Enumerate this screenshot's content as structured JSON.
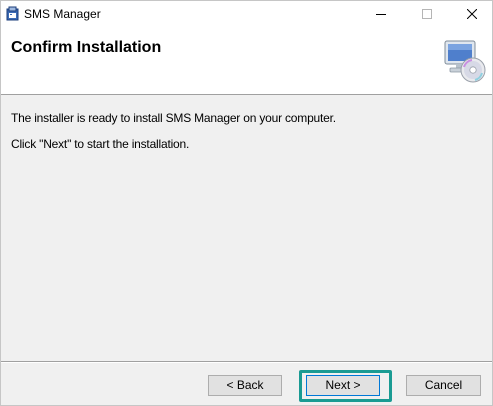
{
  "window": {
    "title": "SMS Manager",
    "controls": {
      "minimize": "minimize",
      "maximize": "maximize",
      "close": "close"
    }
  },
  "banner": {
    "title": "Confirm Installation",
    "icon": "computer-cd-icon"
  },
  "body": {
    "line1": "The installer is ready to install SMS Manager on your computer.",
    "line2": "Click \"Next\" to start the installation."
  },
  "buttons": {
    "back": "< Back",
    "next": "Next >",
    "cancel": "Cancel"
  },
  "colors": {
    "highlight": "#1a9b93",
    "focus": "#0078d7"
  }
}
